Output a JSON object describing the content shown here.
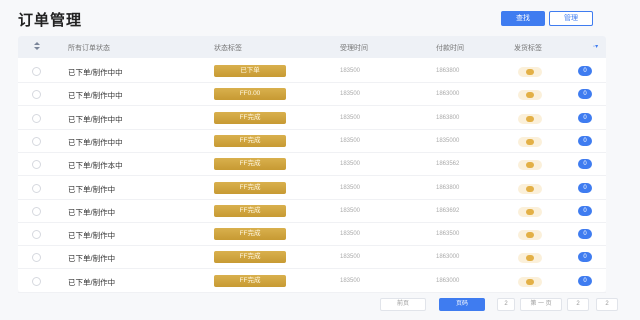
{
  "header": {
    "title": "订单管理",
    "primary_button": "查找",
    "secondary_button": "管理"
  },
  "table": {
    "columns": [
      "所有订单状态",
      "状态标签",
      "受理时间",
      "付款时间",
      "发货标签"
    ],
    "rows": [
      {
        "name": "已下单/制作中中",
        "status": "已下单",
        "time_a": "183500",
        "time_b": "1863800"
      },
      {
        "name": "已下单/制作中中",
        "status": "FF0.00",
        "time_a": "183500",
        "time_b": "1863000"
      },
      {
        "name": "已下单/制作中中",
        "status": "FF完成",
        "time_a": "183500",
        "time_b": "1863800"
      },
      {
        "name": "已下单/制作中中",
        "status": "FF完成",
        "time_a": "183500",
        "time_b": "1835000"
      },
      {
        "name": "已下单/制作本中",
        "status": "FF完成",
        "time_a": "183500",
        "time_b": "1863562"
      },
      {
        "name": "已下单/制作中",
        "status": "FF完成",
        "time_a": "183500",
        "time_b": "1863800"
      },
      {
        "name": "已下单/制作中",
        "status": "FF完成",
        "time_a": "183500",
        "time_b": "1863692"
      },
      {
        "name": "已下单/制作中",
        "status": "FF完成",
        "time_a": "183500",
        "time_b": "1863500"
      },
      {
        "name": "已下单/制作中",
        "status": "FF完成",
        "time_a": "183500",
        "time_b": "1863000"
      },
      {
        "name": "已下单/制作中",
        "status": "FF完成",
        "time_a": "183500",
        "time_b": "1863000"
      }
    ],
    "row_action_label": "0"
  },
  "pager": {
    "prev": "前页",
    "current": "页码",
    "p1": "2",
    "p2": "第 一 页",
    "p3": "2",
    "p4": "2"
  },
  "colors": {
    "accent": "#3f7cf0",
    "gold": "#c79a33"
  }
}
